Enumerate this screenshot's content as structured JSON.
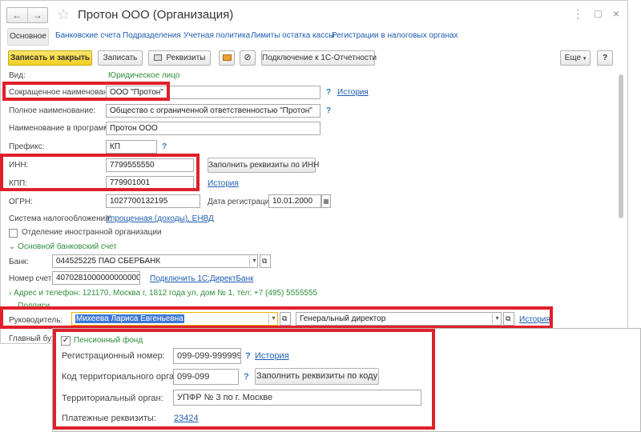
{
  "window": {
    "title": "Протон ООО (Организация)",
    "nav_back": "←",
    "nav_forward": "→",
    "star": "☆",
    "menu_icon": "⋮",
    "maximize_icon": "□",
    "close_icon": "×"
  },
  "tabs": [
    {
      "label": "Основное"
    },
    {
      "label": "Банковские счета"
    },
    {
      "label": "Подразделения"
    },
    {
      "label": "Учетная политика"
    },
    {
      "label": "Лимиты остатка кассы"
    },
    {
      "label": "Регистрации в налоговых органах"
    }
  ],
  "toolbar": {
    "save_close": "Записать и закрыть",
    "save": "Записать",
    "requisites": "Реквизиты",
    "connect": "Подключение к 1С-Отчетности",
    "more": "Еще",
    "help": "?"
  },
  "form": {
    "kind_label": "Вид:",
    "kind_value": "Юридическое лицо",
    "short_name_label": "Сокращенное наименование:",
    "short_name_value": "ООО \"Протон\"",
    "history": "История",
    "full_name_label": "Полное наименование:",
    "full_name_value": "Общество с ограниченной ответственностью \"Протон\"",
    "program_name_label": "Наименование в программе:",
    "program_name_value": "Протон ООО",
    "prefix_label": "Префикс:",
    "prefix_value": "КП",
    "q": "?",
    "inn_label": "ИНН:",
    "inn_value": "7799555550",
    "fill_inn": "Заполнить реквизиты по ИНН",
    "kpp_label": "КПП:",
    "kpp_value": "779901001",
    "ogrn_label": "ОГРН:",
    "ogrn_value": "1027700132195",
    "reg_date_label": "Дата регистрации:",
    "reg_date_value": "10.01.2000",
    "tax_label": "Система налогообложения:",
    "tax_value": "Упрощенная (доходы), ЕНВД",
    "foreign_label": "Отделение иностранной организации",
    "bank_section": "Основной банковский счет",
    "bank_label": "Банк:",
    "bank_value": "044525225 ПАО СБЕРБАНК",
    "account_label": "Номер счета:",
    "account_value": "40702810000000000007",
    "directbank": "Подключить 1С:ДиректБанк",
    "address_line": "Адрес и телефон: 121170, Москва г, 1812 года ул, дом № 1, тел: +7 (495) 5555555",
    "signatures": "Подписи",
    "head_label": "Руководитель:",
    "head_value": "Михеева Лариса Евгеньевна",
    "position_value": "Генеральный директор",
    "chief_acc_label": "Главный бухг"
  },
  "pension": {
    "section": "Пенсионный фонд",
    "reg_number_label": "Регистрационный номер:",
    "reg_number_value": "099-099-999999",
    "history": "История",
    "q": "?",
    "terr_code_label": "Код территориального органа:",
    "terr_code_value": "099-099",
    "fill_by_code": "Заполнить реквизиты по коду",
    "terr_body_label": "Территориальный орган:",
    "terr_body_value": "УПФР № 3 по г. Москве",
    "payment_label": "Платежные реквизиты:",
    "payment_value": "23424"
  }
}
